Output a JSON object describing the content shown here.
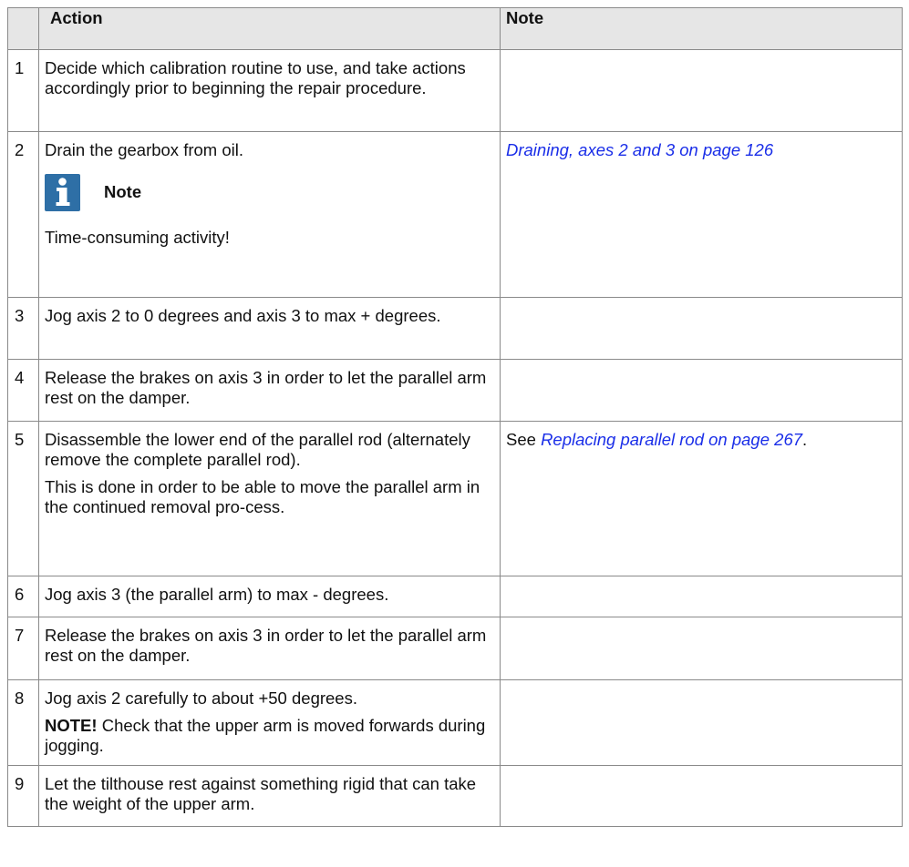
{
  "table": {
    "headers": [
      "",
      "Action",
      "Note"
    ],
    "rows": [
      {
        "num": "1",
        "action": [
          "Decide which calibration routine to use, and take actions accordingly prior to beginning the repair procedure."
        ]
      },
      {
        "num": "2",
        "action": [
          "Drain the gearbox from oil."
        ],
        "note_block": {
          "title": "Note",
          "text": "Time-consuming activity!",
          "icon": "info-icon"
        },
        "note_link": "Draining, axes 2 and 3 on page 126"
      },
      {
        "num": "3",
        "action": [
          "Jog axis 2 to 0 degrees and axis 3 to max + degrees."
        ]
      },
      {
        "num": "4",
        "action": [
          "Release the brakes on axis 3 in order to let the parallel arm rest on the damper."
        ]
      },
      {
        "num": "5",
        "action": [
          "Disassemble the lower end of the parallel rod (alternately remove the complete parallel rod).",
          "This is done in order to be able to move the parallel arm in the continued removal pro-cess."
        ],
        "note_prefix": "See ",
        "note_link": "Replacing parallel rod on page 267",
        "note_suffix": "."
      },
      {
        "num": "6",
        "action": [
          "Jog axis 3 (the parallel arm) to max - degrees."
        ]
      },
      {
        "num": "7",
        "action": [
          "Release the brakes on axis 3 in order to let the parallel arm rest on the damper."
        ]
      },
      {
        "num": "8",
        "action": [
          "Jog axis 2 carefully to about +50 degrees."
        ],
        "action_note_label": "NOTE!",
        "action_note_text": " Check that the upper arm is moved forwards during jogging."
      },
      {
        "num": "9",
        "action": [
          "Let the tilthouse rest against something rigid that can take the weight of the upper arm."
        ]
      }
    ]
  },
  "colors": {
    "header_bg": "#e6e6e6",
    "link": "#1a2ee8",
    "info_icon": "#2e6fa6",
    "border": "#8a8a8a"
  }
}
